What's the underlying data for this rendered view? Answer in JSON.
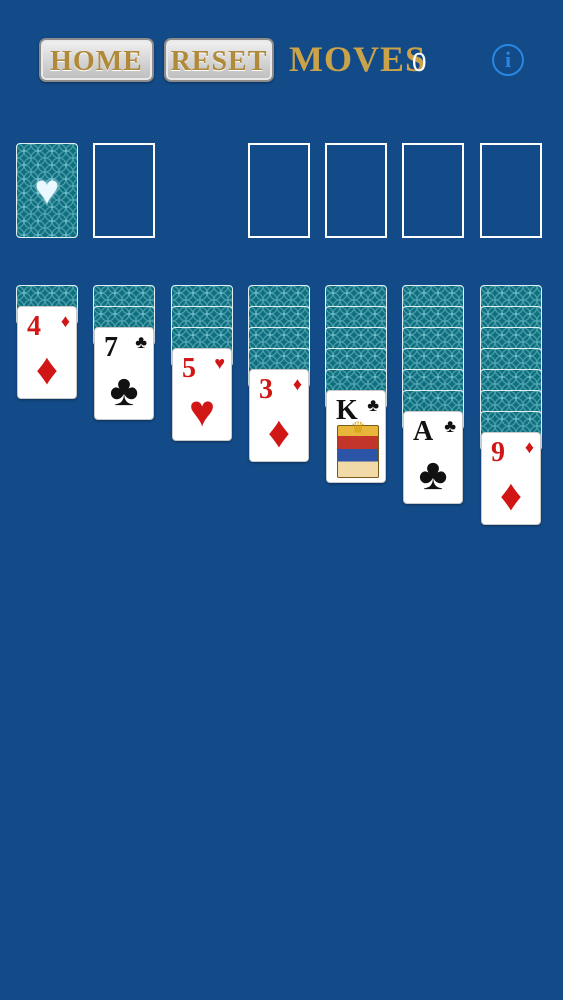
{
  "header": {
    "home_label": "HOME",
    "reset_label": "RESET",
    "moves_label": "MOVES",
    "moves_count": "0",
    "info_label": "i"
  },
  "stock": {
    "emblem": "♥"
  },
  "tableau": [
    {
      "face_down": 1,
      "card": {
        "rank": "4",
        "suit": "♦",
        "color": "red"
      }
    },
    {
      "face_down": 2,
      "card": {
        "rank": "7",
        "suit": "♣",
        "color": "black"
      }
    },
    {
      "face_down": 3,
      "card": {
        "rank": "5",
        "suit": "♥",
        "color": "red"
      }
    },
    {
      "face_down": 4,
      "card": {
        "rank": "3",
        "suit": "♦",
        "color": "red"
      }
    },
    {
      "face_down": 5,
      "card": {
        "rank": "K",
        "suit": "♣",
        "color": "black"
      }
    },
    {
      "face_down": 6,
      "card": {
        "rank": "A",
        "suit": "♣",
        "color": "black"
      }
    },
    {
      "face_down": 7,
      "card": {
        "rank": "9",
        "suit": "♦",
        "color": "red"
      }
    }
  ],
  "colors": {
    "background": "#124b88",
    "moves_gold": "#c9a24a",
    "info_blue": "#2a86e0",
    "card_back": "#0f6f7e",
    "red_suit": "#d11616"
  }
}
